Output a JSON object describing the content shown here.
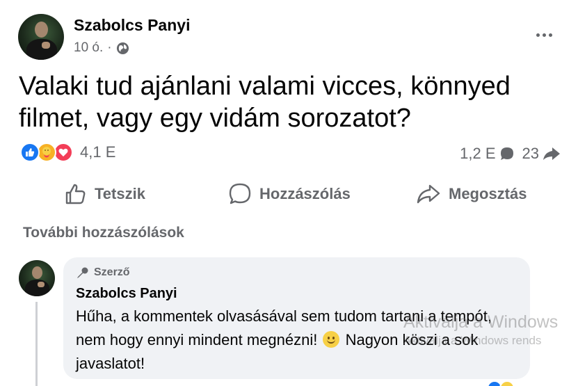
{
  "post": {
    "author": "Szabolcs Panyi",
    "time": "10 ó.",
    "separator": "·",
    "privacy_icon": "globe-icon",
    "text": "Valaki tud ajánlani valami vicces, könnyed filmet, vagy egy vidám sorozatot?",
    "more_icon": "more-horizontal-icon"
  },
  "reactions": {
    "icons": [
      "like-icon",
      "care-icon",
      "love-icon"
    ],
    "count": "4,1 E",
    "comments_count": "1,2 E",
    "shares_count": "23"
  },
  "actions": {
    "like_label": "Tetszik",
    "comment_label": "Hozzászólás",
    "share_label": "Megosztás"
  },
  "comments": {
    "more_label": "További hozzászólások",
    "items": [
      {
        "badge": "Szerző",
        "author": "Szabolcs Panyi",
        "text_before_emoji": "Hűha, a kommentek olvasásával sem tudom tartani a tempót, nem hogy ennyi mindent megnézni!",
        "emoji": "slightly-smiling-face",
        "text_after_emoji": "Nagyon köszi a sok javaslatot!"
      }
    ]
  },
  "watermark": {
    "title": "Aktiválja a Windows",
    "subtitle": "Aktiválja a Windows rends"
  },
  "colors": {
    "text_primary": "#050505",
    "text_secondary": "#65676b",
    "bubble_bg": "#f0f2f5",
    "like_blue": "#1877f2",
    "love_red": "#f33e58",
    "care_yellow": "#f7b125"
  }
}
